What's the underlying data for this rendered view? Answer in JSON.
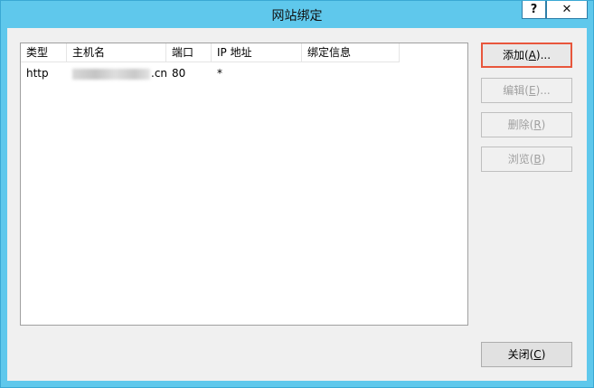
{
  "window": {
    "title": "网站绑定",
    "help_label": "?",
    "close_label": "✕"
  },
  "bindings": {
    "columns": [
      "类型",
      "主机名",
      "端口",
      "IP 地址",
      "绑定信息"
    ],
    "rows": [
      {
        "type": "http",
        "host_visible_suffix": ".cn",
        "port": "80",
        "ip": "*",
        "info": ""
      }
    ]
  },
  "buttons": {
    "add": {
      "label": "添加(",
      "key": "A",
      "tail": ")..."
    },
    "edit": {
      "label": "编辑(",
      "key": "E",
      "tail": ")..."
    },
    "remove": {
      "label": "删除(",
      "key": "R",
      "tail": ")"
    },
    "browse": {
      "label": "浏览(",
      "key": "B",
      "tail": ")"
    },
    "close": {
      "label": "关闭(",
      "key": "C",
      "tail": ")"
    }
  },
  "colors": {
    "title_bar": "#5fc8ec",
    "highlight_border": "#e8563c"
  }
}
